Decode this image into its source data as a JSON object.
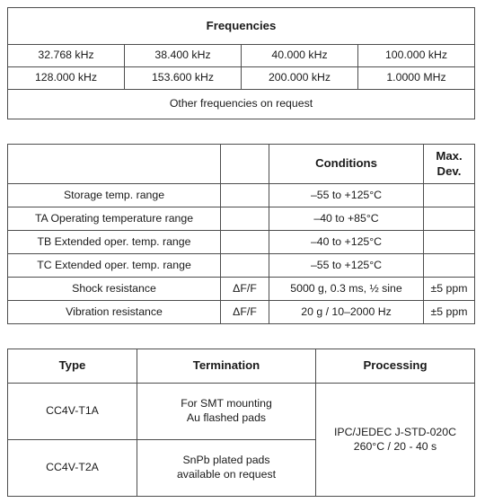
{
  "frequencies_table": {
    "title": "Frequencies",
    "rows": [
      [
        "32.768 kHz",
        "38.400 kHz",
        "40.000 kHz",
        "100.000 kHz"
      ],
      [
        "128.000 kHz",
        "153.600 kHz",
        "200.000 kHz",
        "1.0000 MHz"
      ]
    ],
    "note": "Other frequencies on request"
  },
  "environmental_table": {
    "headers": {
      "parameter": "",
      "symbol": "",
      "conditions": "Conditions",
      "max_dev": "Max. Dev."
    },
    "rows": [
      {
        "parameter": "Storage temp. range",
        "symbol": "",
        "conditions": "–55 to +125°C",
        "max_dev": ""
      },
      {
        "parameter": "TA Operating temperature range",
        "symbol": "",
        "conditions": "–40 to +85°C",
        "max_dev": ""
      },
      {
        "parameter": "TB Extended oper. temp. range",
        "symbol": "",
        "conditions": "–40 to +125°C",
        "max_dev": ""
      },
      {
        "parameter": "TC Extended oper. temp. range",
        "symbol": "",
        "conditions": "–55 to +125°C",
        "max_dev": ""
      },
      {
        "parameter": "Shock resistance",
        "symbol": "ΔF/F",
        "conditions": "5000 g, 0.3 ms, ½ sine",
        "max_dev": "±5 ppm"
      },
      {
        "parameter": "Vibration resistance",
        "symbol": "ΔF/F",
        "conditions": "20 g / 10–2000 Hz",
        "max_dev": "±5 ppm"
      }
    ]
  },
  "types_table": {
    "headers": {
      "type": "Type",
      "termination": "Termination",
      "processing": "Processing"
    },
    "rows": [
      {
        "type": "CC4V-T1A",
        "termination_line1": "For SMT mounting",
        "termination_line2": "Au flashed pads"
      },
      {
        "type": "CC4V-T2A",
        "termination_line1": "SnPb plated pads",
        "termination_line2": "available on request"
      }
    ],
    "processing_line1": "IPC/JEDEC J-STD-020C",
    "processing_line2": "260°C / 20 - 40 s"
  },
  "colors": {
    "border": "#4d4d4d",
    "text": "#1a1a1a",
    "background": "#ffffff"
  }
}
